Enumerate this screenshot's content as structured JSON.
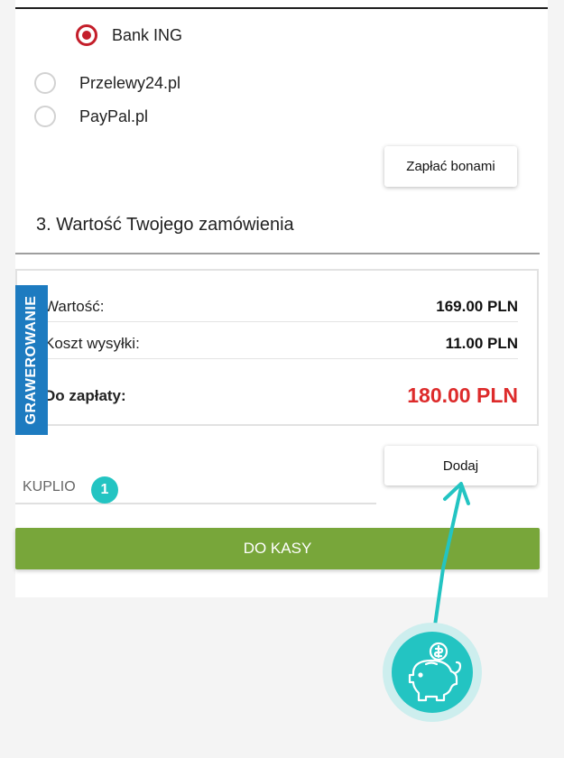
{
  "payment": {
    "options": [
      {
        "label": "Bank ING",
        "selected": true
      },
      {
        "label": "Przelewy24.pl",
        "selected": false
      },
      {
        "label": "PayPal.pl",
        "selected": false
      }
    ],
    "voucher_button": "Zapłać bonami"
  },
  "order": {
    "section_title": "3. Wartość Twojego zamówienia",
    "value_label": "Wartość:",
    "value_amount": "169.00 PLN",
    "shipping_label": "Koszt wysyłki:",
    "shipping_amount": "11.00 PLN",
    "total_label": "Do zapłaty:",
    "total_amount": "180.00 PLN"
  },
  "side_tag": "GRAWEROWANIE",
  "coupon": {
    "value": "KUPLIO",
    "badge": "1",
    "add_button": "Dodaj"
  },
  "checkout_button": "DO KASY",
  "icons": {
    "piggy": "piggy-bank-icon",
    "arrow": "arrow-up-icon"
  },
  "colors": {
    "accent_teal": "#23c4c2",
    "checkout_green": "#78a63a",
    "total_red": "#dd2b2b",
    "radio_red": "#c41e2a",
    "tag_blue": "#1d7bc0"
  }
}
